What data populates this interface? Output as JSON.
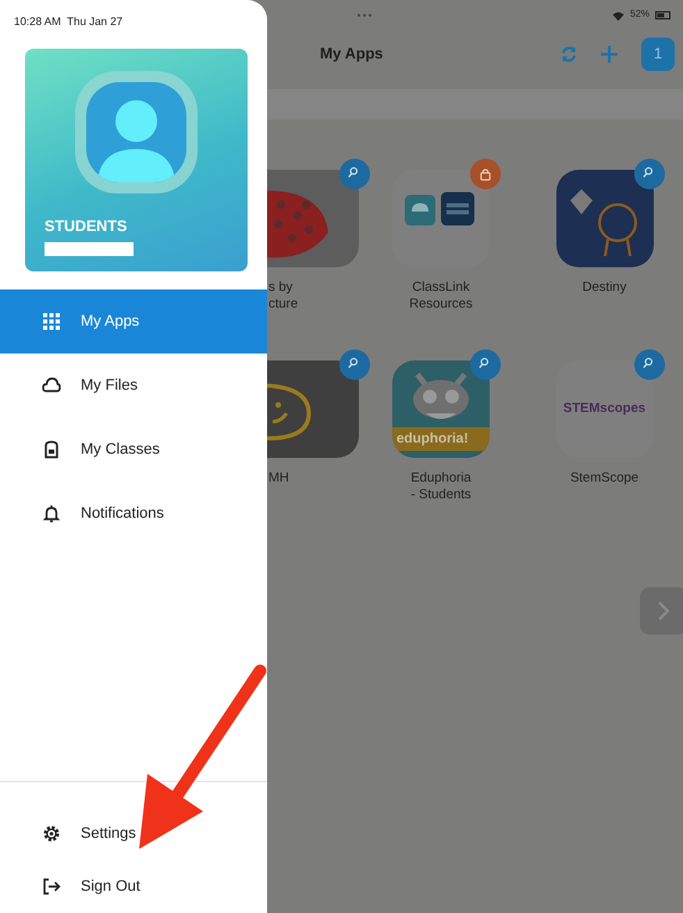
{
  "status_bar": {
    "time": "10:28 AM",
    "date": "Thu Jan 27",
    "battery": "52%"
  },
  "drawer": {
    "profile": {
      "label": "STUDENTS"
    },
    "menu": [
      {
        "label": "My Apps",
        "kind": "apps",
        "selected": true
      },
      {
        "label": "My Files",
        "kind": "files",
        "selected": false
      },
      {
        "label": "My Classes",
        "kind": "classes",
        "selected": false
      },
      {
        "label": "Notifications",
        "kind": "notifications",
        "selected": false
      }
    ],
    "footer": [
      {
        "label": "Settings",
        "kind": "settings"
      },
      {
        "label": "Sign Out",
        "kind": "signout"
      }
    ]
  },
  "header": {
    "title": "My Apps",
    "badge": "1"
  },
  "apps": [
    {
      "label_lines": [
        "s by",
        "cture"
      ],
      "kind": "dots",
      "locked": false,
      "partial": true
    },
    {
      "label_lines": [
        "ClassLink",
        "Resources"
      ],
      "kind": "classlink",
      "locked": true,
      "partial": false
    },
    {
      "label_lines": [
        "Destiny"
      ],
      "kind": "destiny",
      "locked": false,
      "partial": false
    },
    {
      "label_lines": [
        "MH"
      ],
      "kind": "smile",
      "locked": false,
      "partial": true
    },
    {
      "label_lines": [
        "Eduphoria",
        "- Students"
      ],
      "kind": "eduphoria",
      "locked": false,
      "partial": false,
      "logo_text": "eduphoria!"
    },
    {
      "label_lines": [
        "StemScope"
      ],
      "kind": "stemscopes",
      "locked": false,
      "partial": false,
      "logo_text": "STEMscopes"
    }
  ]
}
